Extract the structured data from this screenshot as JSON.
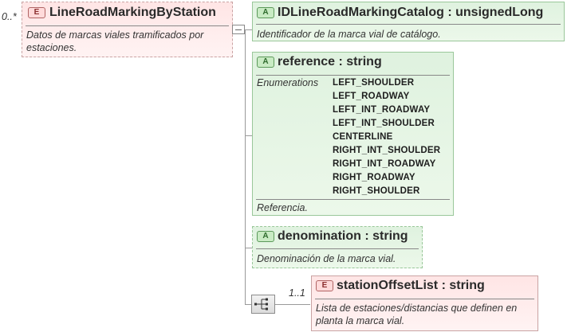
{
  "root": {
    "multiplicity": "0..*",
    "badge": "E",
    "name": "LineRoadMarkingByStation",
    "description": "Datos de marcas viales tramificados por estaciones."
  },
  "children": [
    {
      "badge": "A",
      "name": "IDLineRoadMarkingCatalog",
      "type": "unsignedLong",
      "description": "Identificador de la marca vial de catálogo."
    },
    {
      "badge": "A",
      "name": "reference",
      "type": "string",
      "enumerations_label": "Enumerations",
      "enumerations": [
        "LEFT_SHOULDER",
        "LEFT_ROADWAY",
        "LEFT_INT_ROADWAY",
        "LEFT_INT_SHOULDER",
        "CENTERLINE",
        "RIGHT_INT_SHOULDER",
        "RIGHT_INT_ROADWAY",
        "RIGHT_ROADWAY",
        "RIGHT_SHOULDER"
      ],
      "description": "Referencia."
    },
    {
      "badge": "A",
      "name": "denomination",
      "type": "string",
      "description": "Denominación de la marca vial."
    },
    {
      "badge": "E",
      "multiplicity": "1..1",
      "name": "stationOffsetList",
      "type": "string",
      "description": "Lista de estaciones/distancias que definen en planta la marca vial."
    }
  ],
  "colors": {
    "attribute_fill": "#dff2df",
    "attribute_border": "#9ac79a",
    "element_fill": "#ffe5e5",
    "element_border": "#c9a3a3"
  },
  "icons": {
    "sequence_compositor": "sequence-compositor-icon",
    "expand": "collapse-box-icon"
  }
}
